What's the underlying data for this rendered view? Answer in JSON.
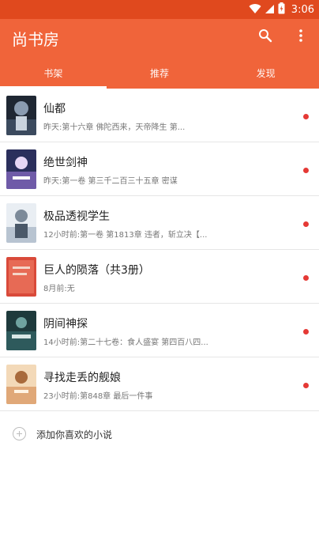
{
  "status_bar": {
    "time": "3:06",
    "icons": [
      "wifi-icon",
      "signal-icon",
      "battery-icon"
    ]
  },
  "app_bar": {
    "title": "尚书房",
    "actions": [
      "search-icon",
      "more-vert-icon"
    ]
  },
  "tabs": [
    {
      "label": "书架",
      "active": true
    },
    {
      "label": "推荐",
      "active": false
    },
    {
      "label": "发现",
      "active": false
    }
  ],
  "books": [
    {
      "title": "仙都",
      "latest": "昨天:第十六章 佛陀西来，天帝降生 第...",
      "unread": true
    },
    {
      "title": "绝世剑神",
      "latest": "昨天:第一卷 第三千二百三十五章 密谋",
      "unread": true
    },
    {
      "title": "极品透视学生",
      "latest": "12小时前:第一卷 第1813章 违者，斩立决【...",
      "unread": true
    },
    {
      "title": "巨人的陨落（共3册）",
      "latest": "8月前:无",
      "unread": true
    },
    {
      "title": "阴间神探",
      "latest": "14小时前:第二十七卷：食人盛宴 第四百八四...",
      "unread": true
    },
    {
      "title": "寻找走丢的舰娘",
      "latest": "23小时前:第848章 最后一件事",
      "unread": true
    }
  ],
  "add_novel": {
    "label": "添加你喜欢的小说"
  },
  "colors": {
    "primary": "#f0643a",
    "primary_dark": "#e0491e",
    "unread_dot": "#e53935"
  }
}
